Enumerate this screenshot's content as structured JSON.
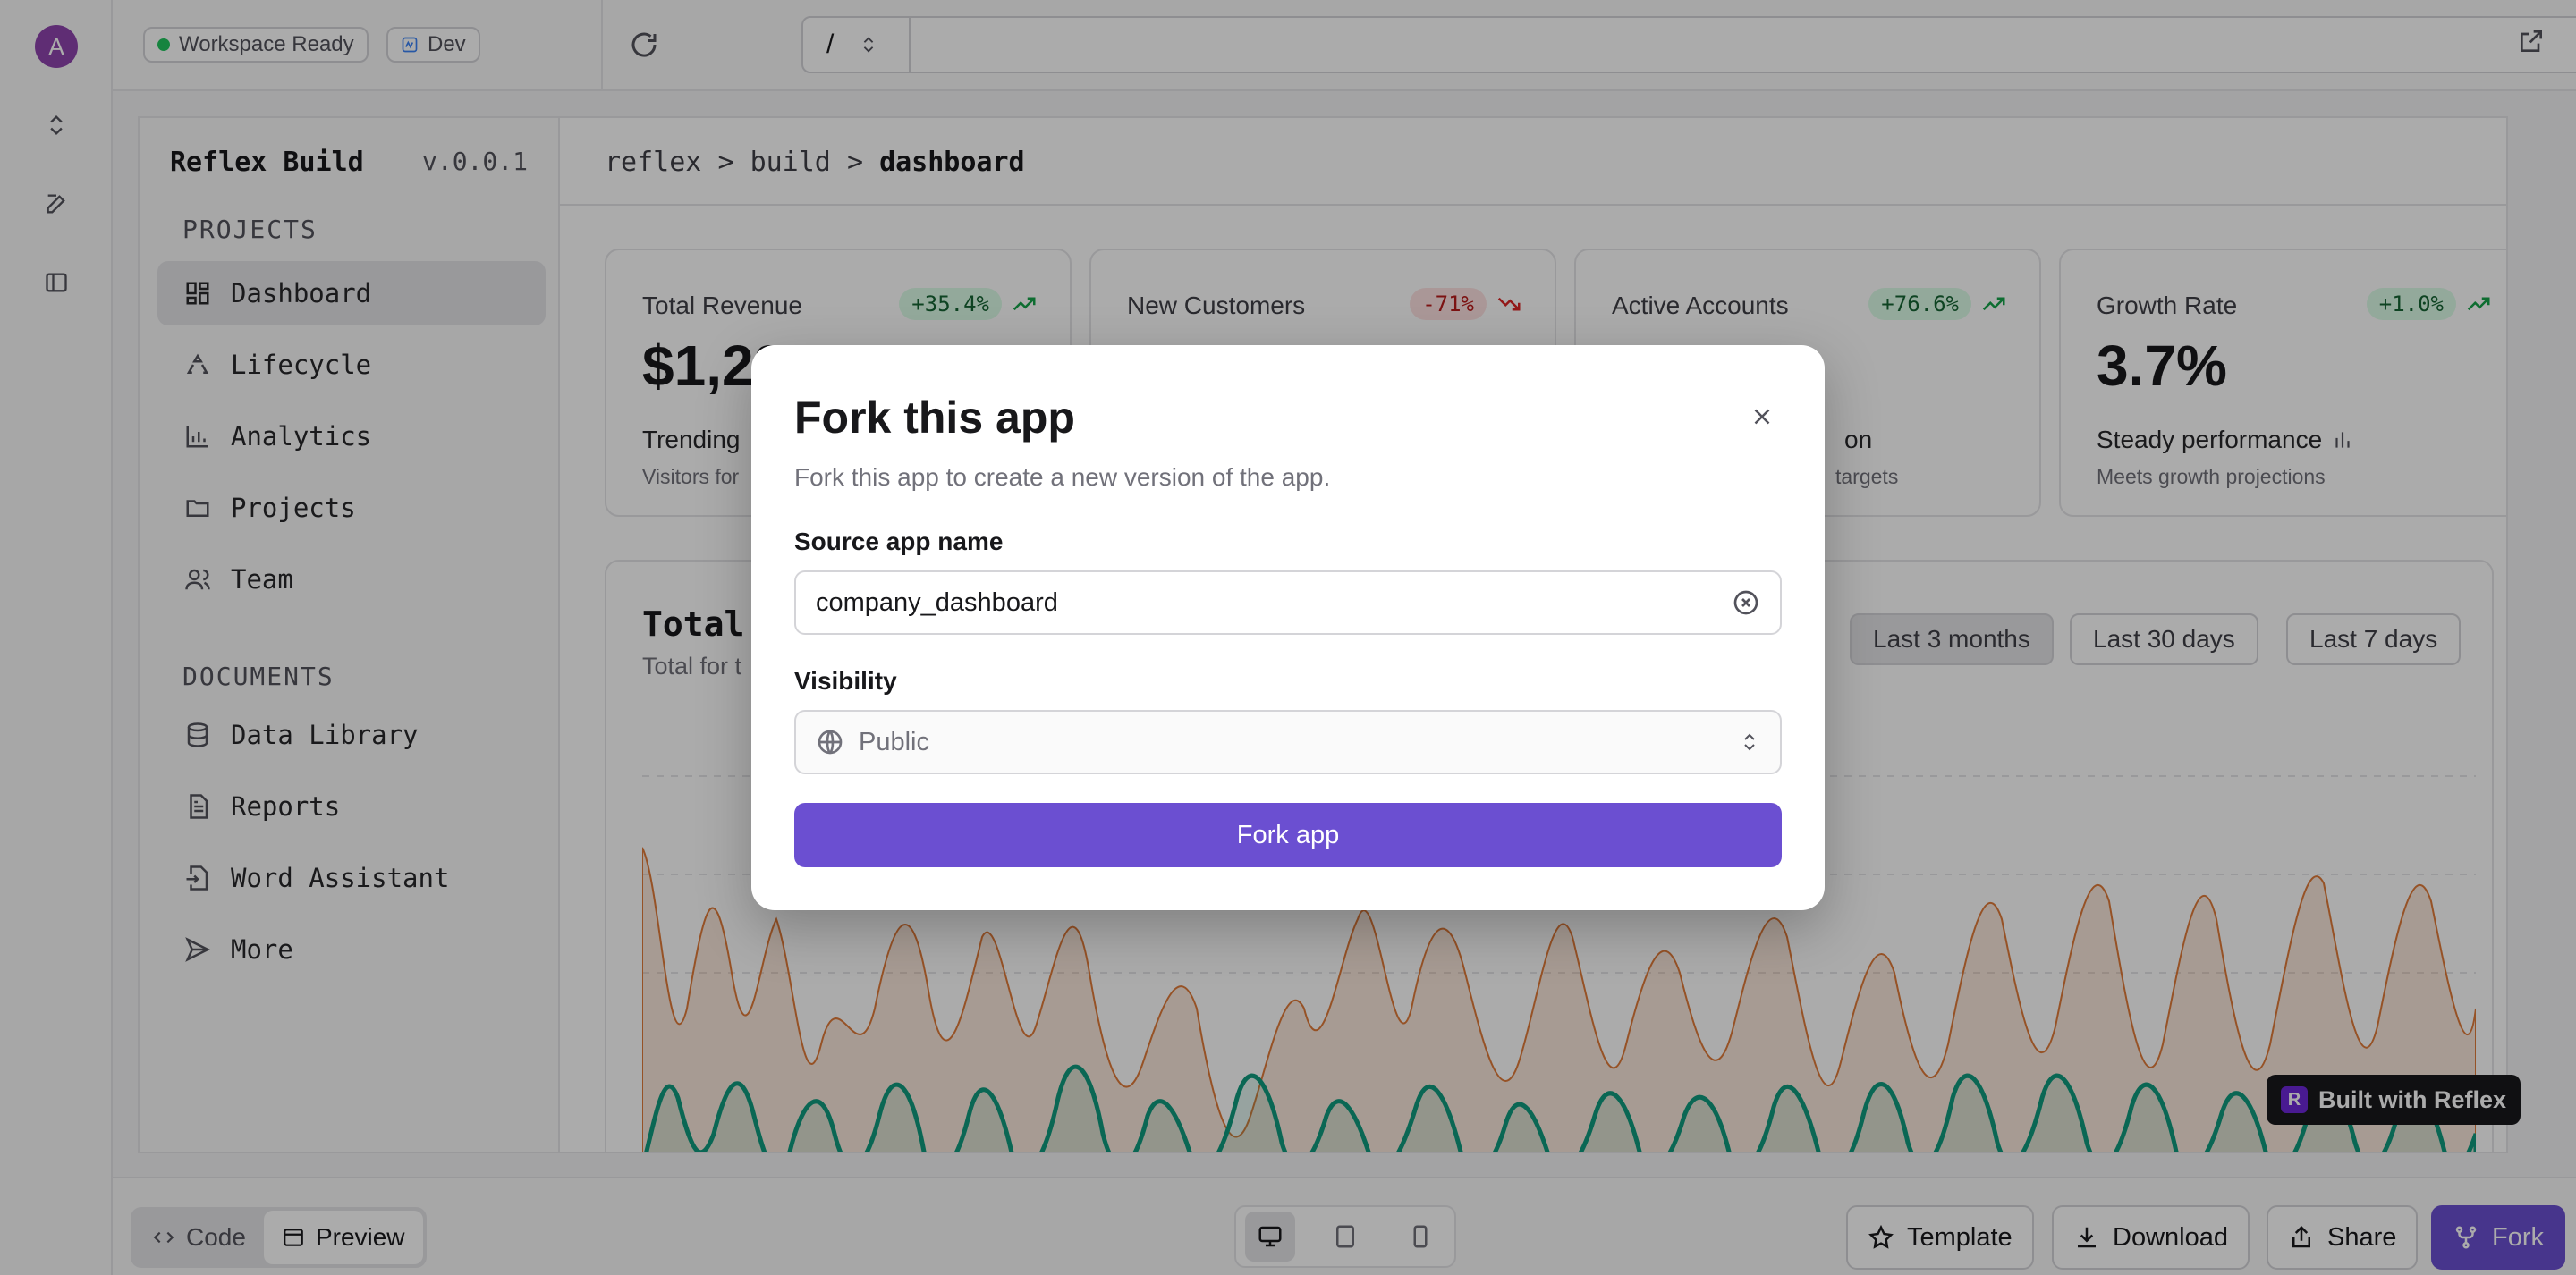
{
  "rail": {
    "avatar_letter": "A"
  },
  "topbar": {
    "status_label": "Workspace Ready",
    "env_label": "Dev",
    "path_value": "/"
  },
  "sidebar": {
    "brand": "Reflex Build",
    "version": "v.0.0.1",
    "projects_heading": "PROJECTS",
    "project_items": [
      {
        "label": "Dashboard",
        "icon": "grid-icon"
      },
      {
        "label": "Lifecycle",
        "icon": "recycle-icon"
      },
      {
        "label": "Analytics",
        "icon": "bar-chart-icon"
      },
      {
        "label": "Projects",
        "icon": "folder-icon"
      },
      {
        "label": "Team",
        "icon": "users-icon"
      }
    ],
    "documents_heading": "DOCUMENTS",
    "document_items": [
      {
        "label": "Data Library",
        "icon": "database-icon"
      },
      {
        "label": "Reports",
        "icon": "file-icon"
      },
      {
        "label": "Word Assistant",
        "icon": "file-input-icon"
      },
      {
        "label": "More",
        "icon": "send-icon"
      }
    ]
  },
  "breadcrumb": {
    "part1": "reflex",
    "part2": "build",
    "part3": "dashboard",
    "sep": ">"
  },
  "cards": [
    {
      "label": "Total Revenue",
      "badge": "+35.4%",
      "trend": "up",
      "value": "$1,22",
      "sub1": "Trending",
      "sub2": "Visitors for"
    },
    {
      "label": "New Customers",
      "badge": "-71%",
      "trend": "down",
      "value": "",
      "sub1": "",
      "sub2": ""
    },
    {
      "label": "Active Accounts",
      "badge": "+76.6%",
      "trend": "up",
      "value": "",
      "sub1": "on",
      "sub2": "targets"
    },
    {
      "label": "Growth Rate",
      "badge": "+1.0%",
      "trend": "up",
      "value": "3.7%",
      "sub1": "Steady performance",
      "sub2": "Meets growth projections"
    }
  ],
  "chart_section": {
    "title": "Total",
    "subtitle": "Total for t",
    "ranges": [
      "Last 3 months",
      "Last 30 days",
      "Last 7 days"
    ],
    "selected_range": "Last 3 months"
  },
  "built_with": "Built with Reflex",
  "bottombar": {
    "code_label": "Code",
    "preview_label": "Preview",
    "template_label": "Template",
    "download_label": "Download",
    "share_label": "Share",
    "fork_label": "Fork"
  },
  "modal": {
    "title": "Fork this app",
    "description": "Fork this app to create a new version of the app.",
    "source_label": "Source app name",
    "source_value": "company_dashboard",
    "visibility_label": "Visibility",
    "visibility_value": "Public",
    "submit_label": "Fork app"
  },
  "colors": {
    "primary": "#6b4fd1",
    "series_orange": "#e07b39",
    "series_teal": "#0f9a7e",
    "badge_up_bg": "#dcfce7",
    "badge_down_bg": "#fee2e2"
  }
}
